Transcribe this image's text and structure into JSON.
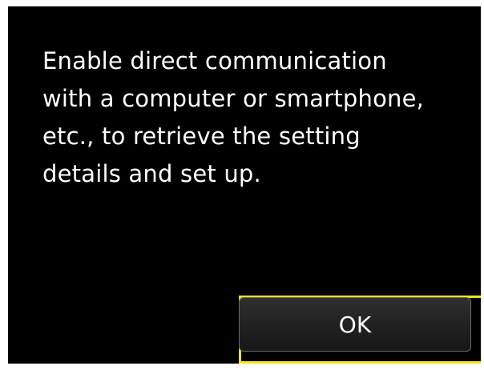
{
  "dialog": {
    "message": "Enable direct communication\nwith a computer or smartphone,\netc., to retrieve the setting\ndetails and set up.",
    "ok_label": "OK"
  },
  "colors": {
    "background": "#000000",
    "text": "#ffffff",
    "focus": "#f2e321"
  }
}
